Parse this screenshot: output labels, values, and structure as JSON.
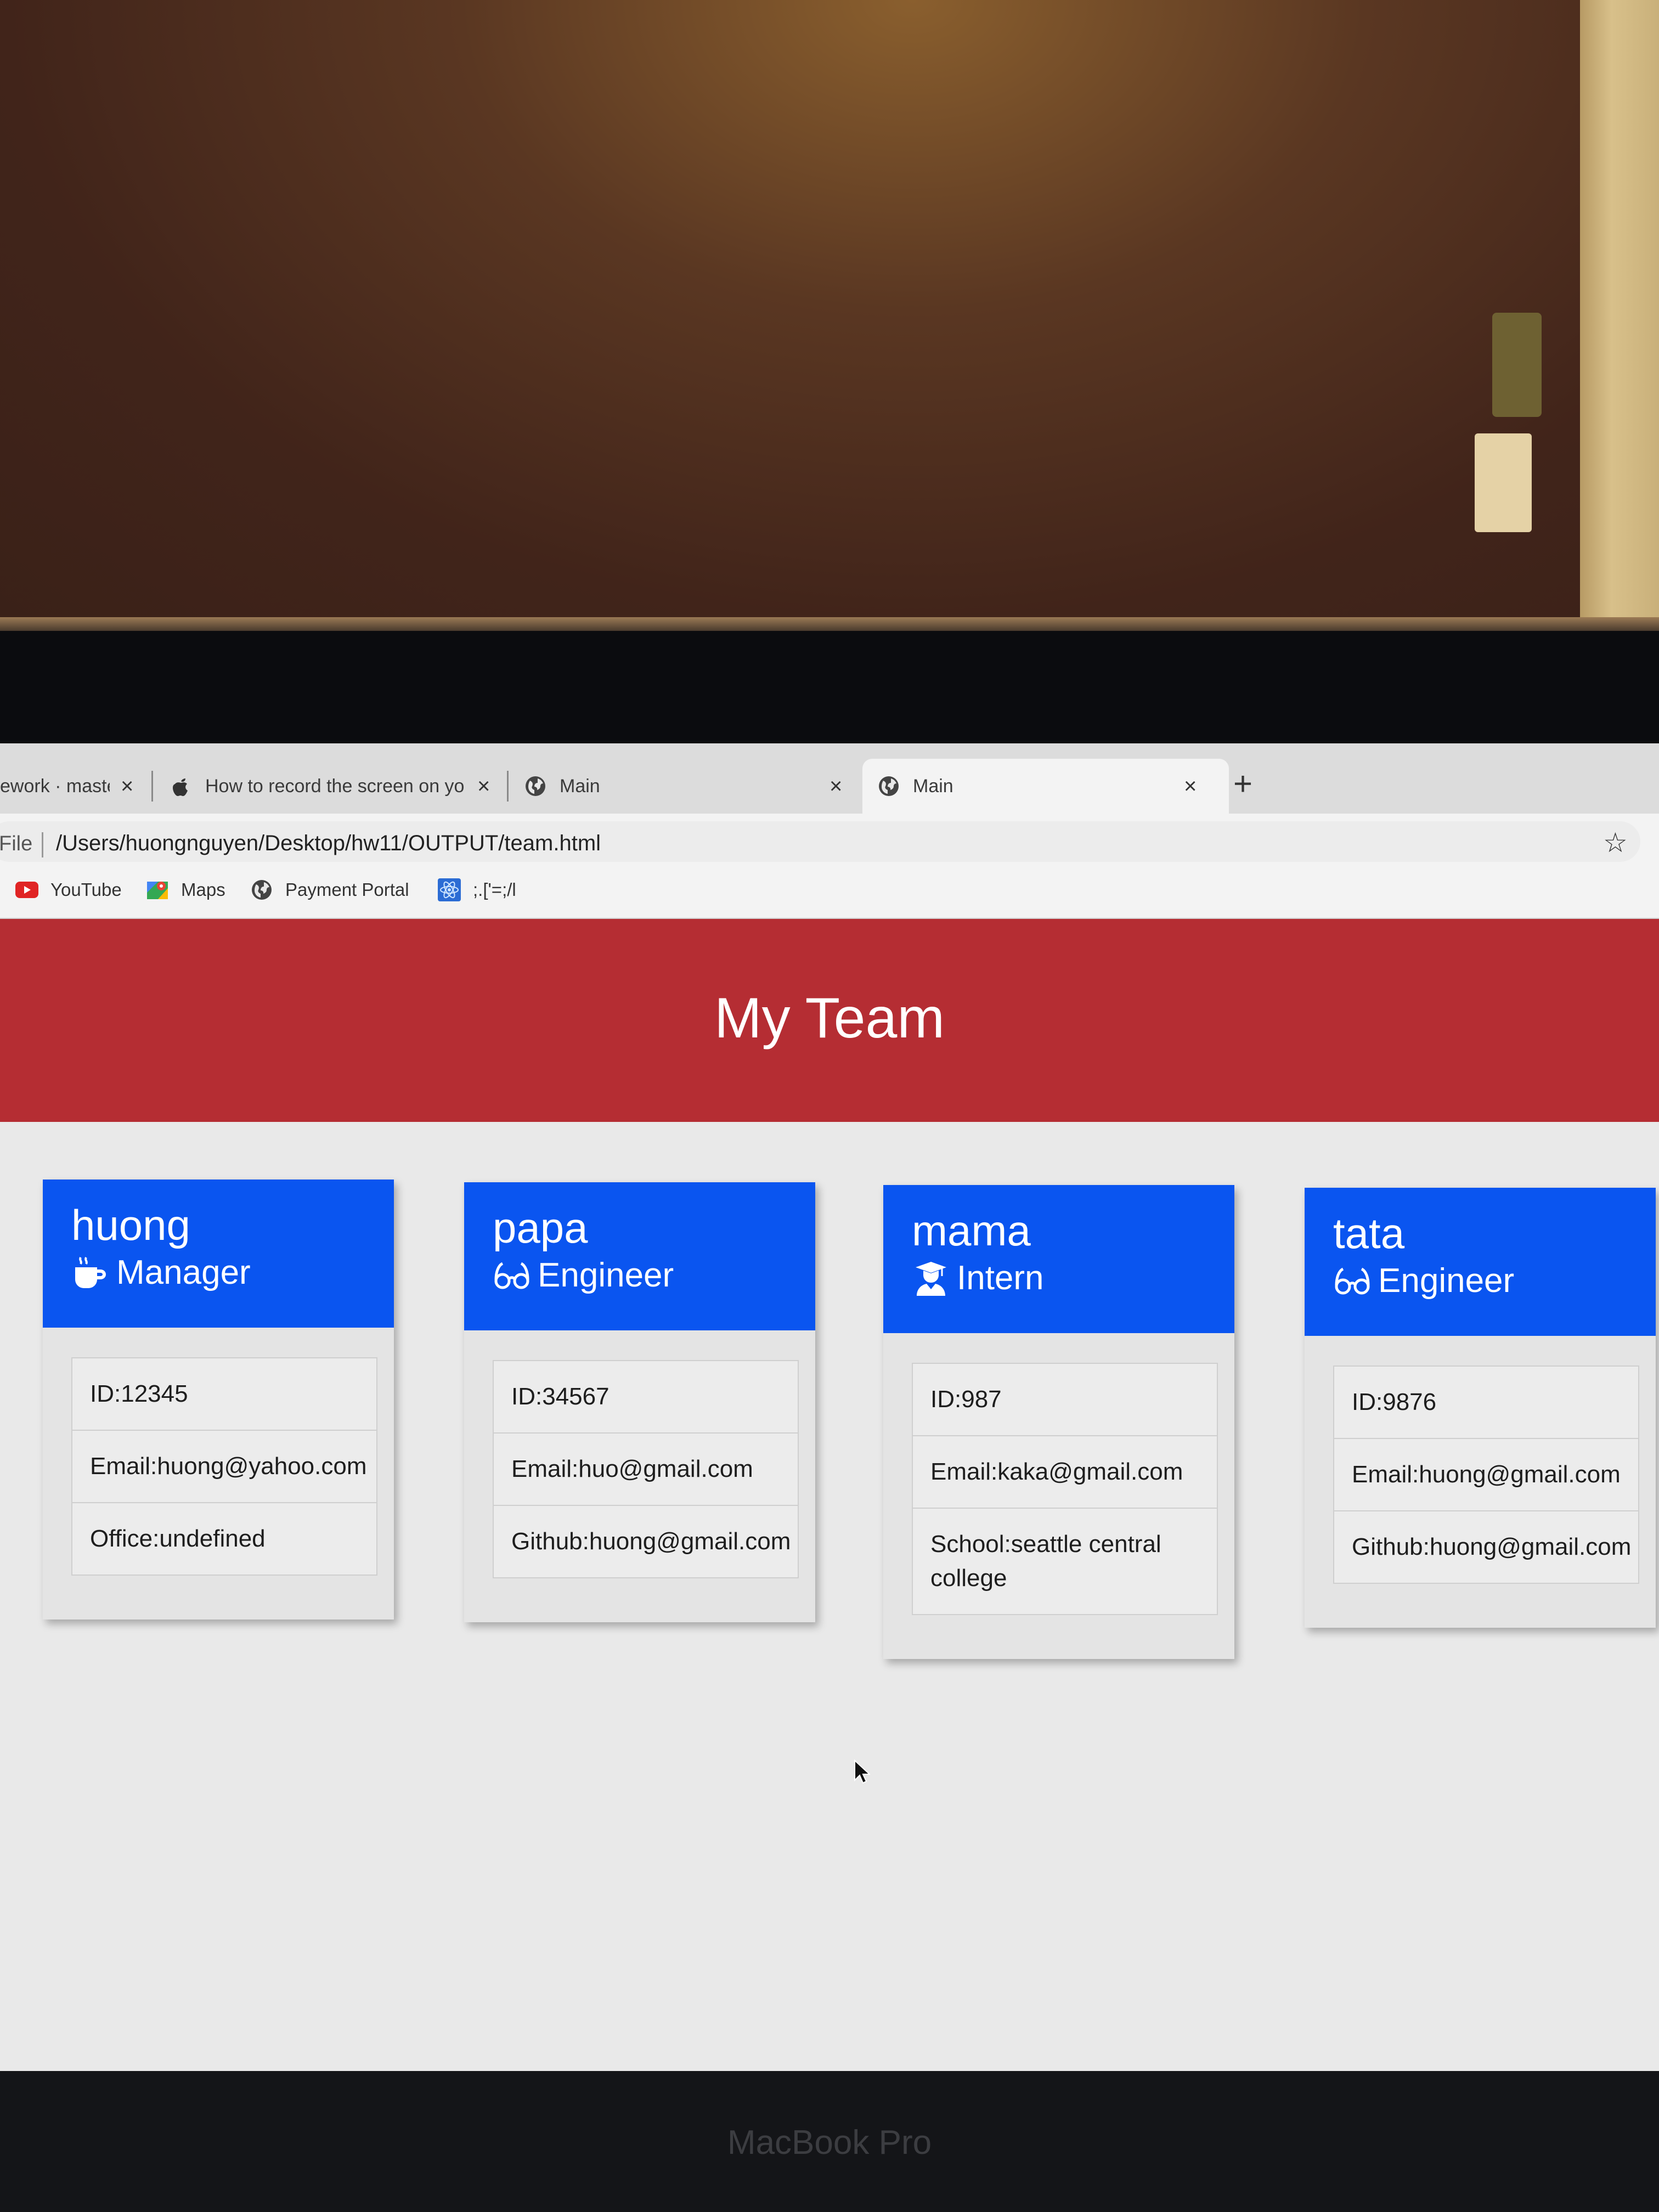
{
  "browser": {
    "tabs": [
      {
        "title": "ework · maste",
        "icon": "github-icon",
        "active": false
      },
      {
        "title": "How to record the screen on yo",
        "icon": "apple-icon",
        "active": false
      },
      {
        "title": "Main",
        "icon": "globe-icon",
        "active": false
      },
      {
        "title": "Main",
        "icon": "globe-icon",
        "active": true
      }
    ],
    "close_glyph": "×",
    "new_tab_glyph": "+",
    "address": {
      "scheme_label": "File",
      "url": "/Users/huongnguyen/Desktop/hw11/OUTPUT/team.html",
      "bookmark_icon": "star-icon"
    },
    "bookmarks": [
      {
        "label": "YouTube",
        "icon": "youtube-icon"
      },
      {
        "label": "Maps",
        "icon": "maps-icon"
      },
      {
        "label": "Payment Portal",
        "icon": "globe-icon"
      },
      {
        "label": ";.['=;/l",
        "icon": "react-icon"
      }
    ]
  },
  "page": {
    "title": "My Team",
    "colors": {
      "header": "#b52d33",
      "card_header": "#0a55f0"
    },
    "cards": [
      {
        "name": "huong",
        "role": "Manager",
        "role_icon": "coffee-icon",
        "fields": [
          "ID:12345",
          "Email:huong@yahoo.com",
          "Office:undefined"
        ]
      },
      {
        "name": "papa",
        "role": "Engineer",
        "role_icon": "glasses-icon",
        "fields": [
          "ID:34567",
          "Email:huo@gmail.com",
          "Github:huong@gmail.com"
        ]
      },
      {
        "name": "mama",
        "role": "Intern",
        "role_icon": "graduate-icon",
        "fields": [
          "ID:987",
          "Email:kaka@gmail.com",
          "School:seattle central college"
        ]
      },
      {
        "name": "tata",
        "role": "Engineer",
        "role_icon": "glasses-icon",
        "fields": [
          "ID:9876",
          "Email:huong@gmail.com",
          "Github:huong@gmail.com"
        ]
      }
    ]
  },
  "device": {
    "brand": "MacBook Pro"
  }
}
